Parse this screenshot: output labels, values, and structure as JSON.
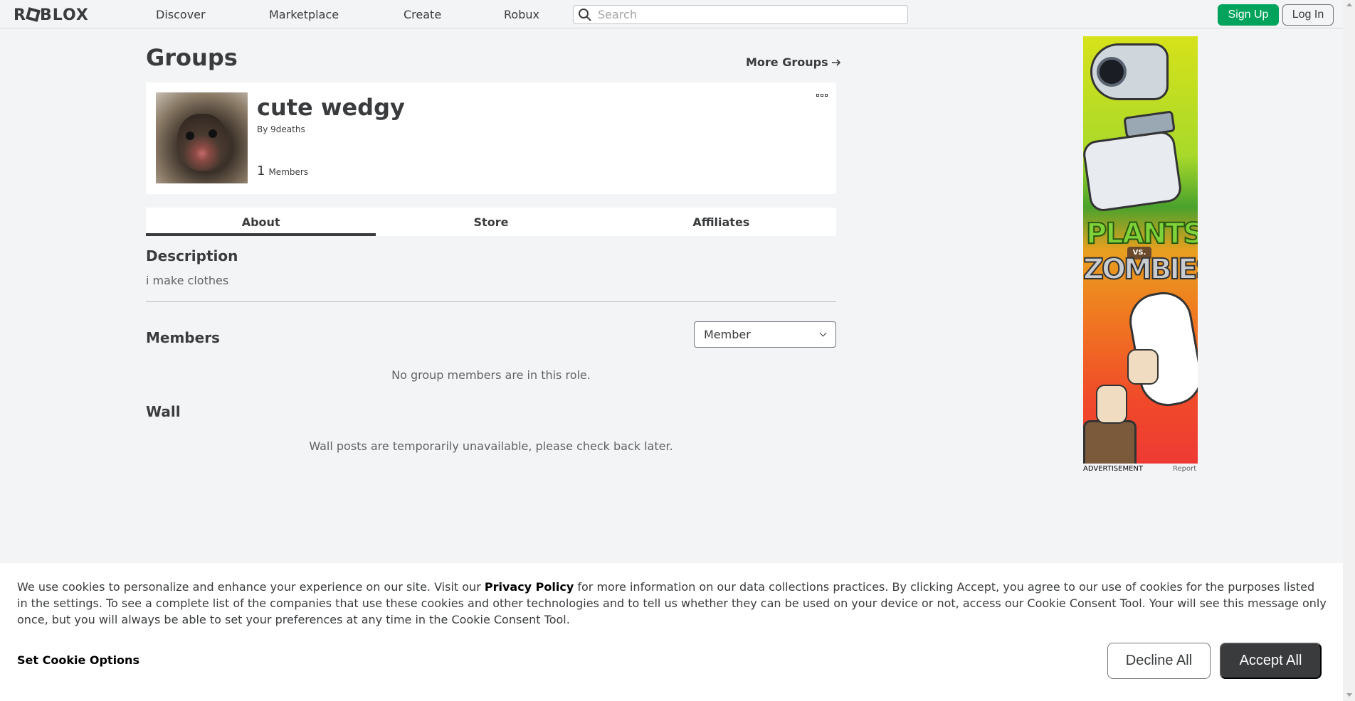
{
  "header": {
    "logo": "ROBLOX",
    "nav": [
      {
        "label": "Discover"
      },
      {
        "label": "Marketplace"
      },
      {
        "label": "Create"
      },
      {
        "label": "Robux"
      }
    ],
    "search_placeholder": "Search",
    "signup_label": "Sign Up",
    "login_label": "Log In"
  },
  "page": {
    "title": "Groups",
    "more_groups_label": "More Groups"
  },
  "group": {
    "name": "cute wedgy",
    "by_prefix": "By",
    "owner": "9deaths",
    "member_count": "1",
    "members_label": "Members"
  },
  "tabs": [
    {
      "label": "About",
      "active": true
    },
    {
      "label": "Store",
      "active": false
    },
    {
      "label": "Affiliates",
      "active": false
    }
  ],
  "about": {
    "description_heading": "Description",
    "description_text": "i make clothes",
    "members_heading": "Members",
    "role_selected": "Member",
    "no_members_msg": "No group members are in this role.",
    "wall_heading": "Wall",
    "wall_msg": "Wall posts are temporarily unavailable, please check back later."
  },
  "ad": {
    "label": "ADVERTISEMENT",
    "report_label": "Report",
    "art_title_1": "PLANTS",
    "art_vs": "VS.",
    "art_title_2": "ZOMBIES"
  },
  "cookie": {
    "text_before_link": "We use cookies to personalize and enhance your experience on our site. Visit our ",
    "privacy_link": "Privacy Policy",
    "text_after_link": " for more information on our data collections practices. By clicking Accept, you agree to our use of cookies for the purposes listed in the settings. To see a complete list of the companies that use these cookies and other technologies and to tell us whether they can be used on your device or not, access our Cookie Consent Tool. Your will see this message only once, but you will always be able to set your preferences at any time in the Cookie Consent Tool.",
    "options_label": "Set Cookie Options",
    "decline_label": "Decline All",
    "accept_label": "Accept All"
  },
  "colors": {
    "brand_green": "#00a35c",
    "text_dark": "#393b3d",
    "page_bg": "#f2f4f5"
  }
}
